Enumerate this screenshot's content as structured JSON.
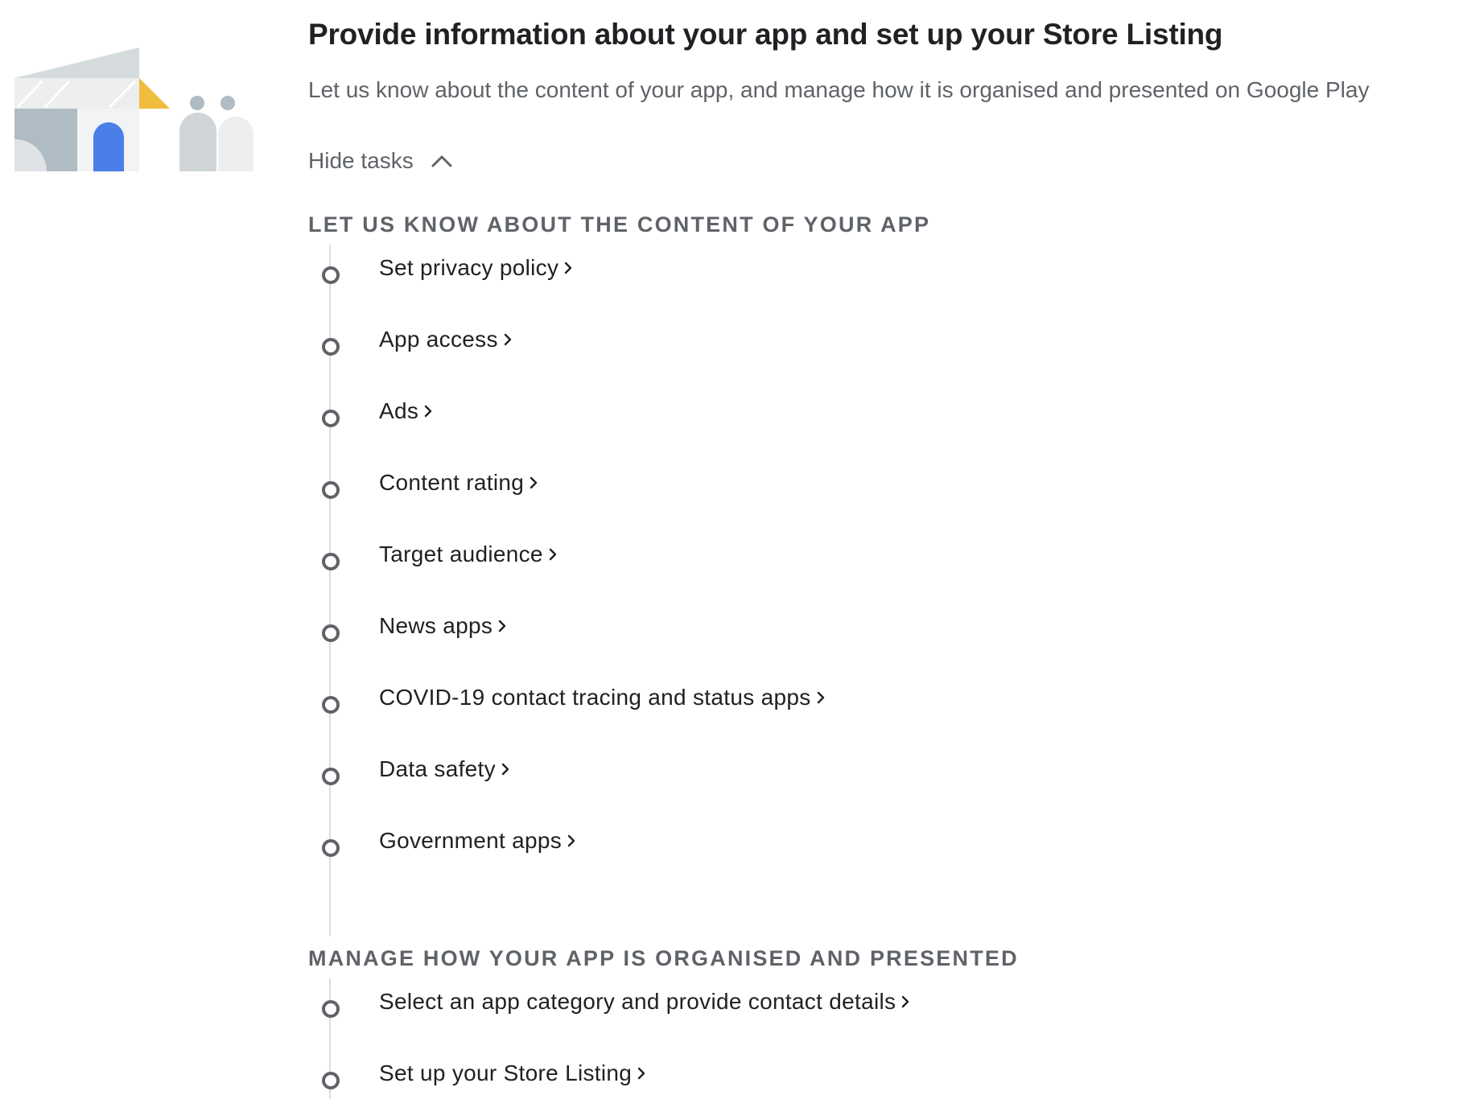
{
  "header": {
    "title": "Provide information about your app and set up your Store Listing",
    "subtitle": "Let us know about the content of your app, and manage how it is organised and presented on Google Play",
    "toggle_label": "Hide tasks",
    "toggle_icon": "chevron-up-icon"
  },
  "colors": {
    "accent_blue": "#4a7fe8",
    "accent_yellow": "#f0bc3e",
    "muted_text": "#5f6368",
    "timeline": "#dadce0"
  },
  "sections": [
    {
      "heading": "LET US KNOW ABOUT THE CONTENT OF YOUR APP",
      "tasks": [
        {
          "label": "Set privacy policy"
        },
        {
          "label": "App access"
        },
        {
          "label": "Ads"
        },
        {
          "label": "Content rating"
        },
        {
          "label": "Target audience"
        },
        {
          "label": "News apps"
        },
        {
          "label": "COVID-19 contact tracing and status apps"
        },
        {
          "label": "Data safety"
        },
        {
          "label": "Government apps"
        }
      ]
    },
    {
      "heading": "MANAGE HOW YOUR APP IS ORGANISED AND PRESENTED",
      "tasks": [
        {
          "label": "Select an app category and provide contact details"
        },
        {
          "label": "Set up your Store Listing"
        }
      ]
    }
  ]
}
